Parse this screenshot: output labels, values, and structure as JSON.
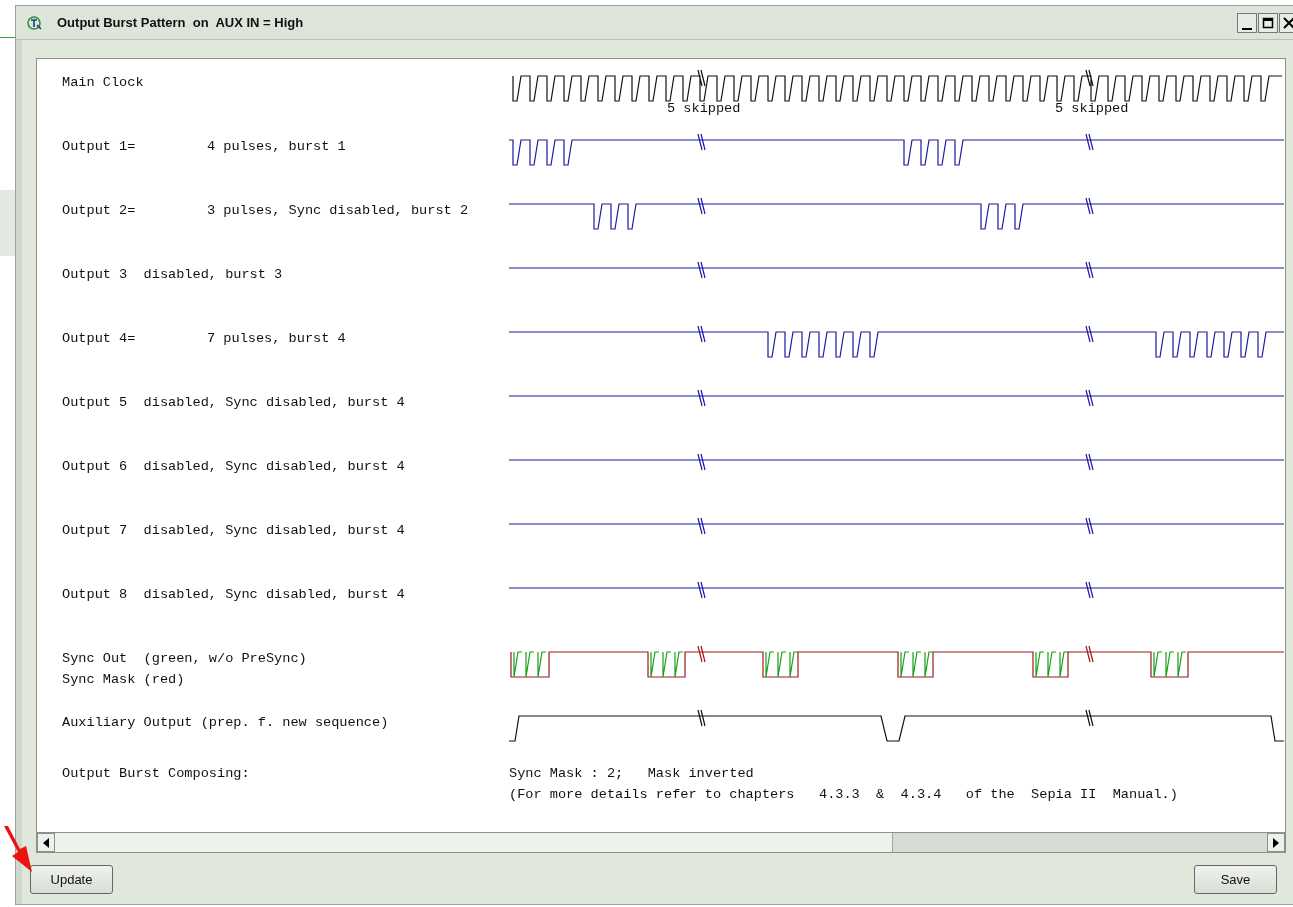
{
  "window": {
    "title": "Output Burst Pattern  on  AUX IN = High"
  },
  "traces": [
    {
      "kind": "clock",
      "labels": [
        "Main Clock"
      ],
      "skip_labels": [
        "5 skipped",
        "5 skipped"
      ]
    },
    {
      "kind": "output",
      "labels": [
        "Output 1="
      ],
      "detail": "4 pulses, burst 1"
    },
    {
      "kind": "output",
      "labels": [
        "Output 2="
      ],
      "detail": "3 pulses, Sync disabled, burst 2"
    },
    {
      "kind": "output",
      "labels": [
        "Output 3  disabled, burst 3"
      ]
    },
    {
      "kind": "output",
      "labels": [
        "Output 4="
      ],
      "detail": "7 pulses, burst 4"
    },
    {
      "kind": "output",
      "labels": [
        "Output 5  disabled, Sync disabled, burst 4"
      ]
    },
    {
      "kind": "output",
      "labels": [
        "Output 6  disabled, Sync disabled, burst 4"
      ]
    },
    {
      "kind": "output",
      "labels": [
        "Output 7  disabled, Sync disabled, burst 4"
      ]
    },
    {
      "kind": "output",
      "labels": [
        "Output 8  disabled, Sync disabled, burst 4"
      ]
    },
    {
      "kind": "sync",
      "labels": [
        "Sync Out  (green, w/o PreSync)",
        "Sync Mask (red)"
      ]
    },
    {
      "kind": "aux",
      "labels": [
        "Auxiliary Output (prep. f. new sequence)"
      ]
    }
  ],
  "composing": {
    "label": "Output Burst Composing:",
    "lines": [
      "Sync Mask : 2;   Mask inverted",
      "(For more details refer to chapters   4.3.3  &  4.3.4   of the  Sepia II  Manual.)"
    ]
  },
  "buttons": {
    "update": "Update",
    "save": "Save"
  }
}
